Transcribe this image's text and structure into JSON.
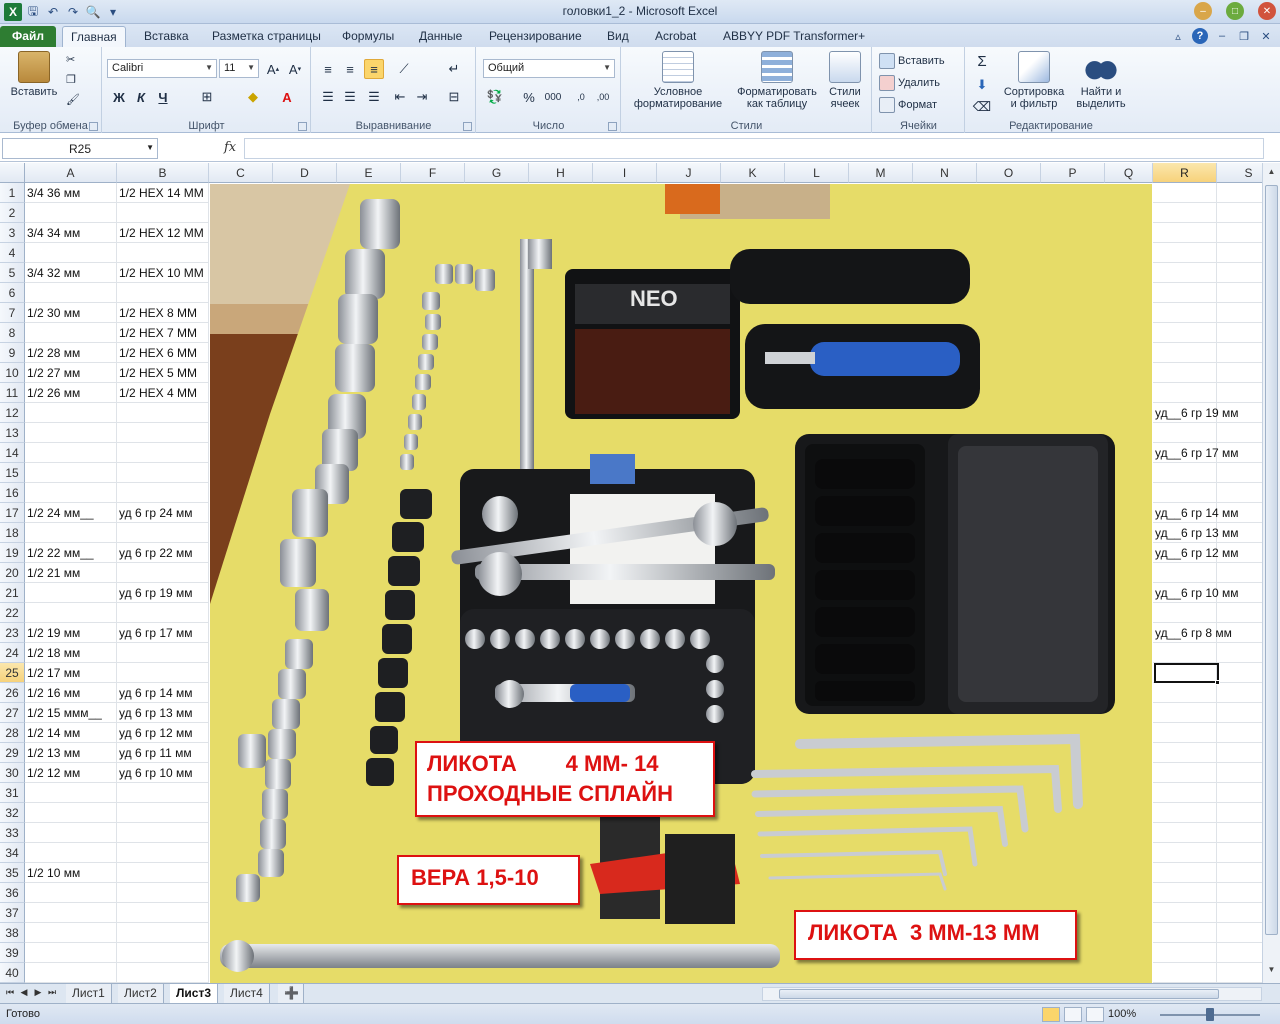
{
  "window": {
    "title": "головки1_2  -  Microsoft Excel",
    "app_icon": "X"
  },
  "ribbon_tabs": [
    "Файл",
    "Главная",
    "Вставка",
    "Разметка страницы",
    "Формулы",
    "Данные",
    "Рецензирование",
    "Вид",
    "Acrobat",
    "ABBYY PDF Transformer+"
  ],
  "ribbon": {
    "clipboard": {
      "group": "Буфер обмена",
      "paste": "Вставить"
    },
    "font": {
      "group": "Шрифт",
      "name": "Calibri",
      "size": "11",
      "bold": "Ж",
      "italic": "К",
      "underline": "Ч"
    },
    "alignment": {
      "group": "Выравнивание"
    },
    "number": {
      "group": "Число",
      "format": "Общий"
    },
    "styles": {
      "group": "Стили",
      "conditional": "Условное форматирование",
      "as_table": "Форматировать как таблицу",
      "cell_styles": "Стили ячеек"
    },
    "cells": {
      "group": "Ячейки",
      "insert": "Вставить",
      "delete": "Удалить",
      "format": "Формат"
    },
    "editing": {
      "group": "Редактирование",
      "sort": "Сортировка и фильтр",
      "find": "Найти и выделить"
    }
  },
  "formula_bar": {
    "name_box": "R25",
    "fx": "fx",
    "value": ""
  },
  "columns": [
    "A",
    "B",
    "C",
    "D",
    "E",
    "F",
    "G",
    "H",
    "I",
    "J",
    "K",
    "L",
    "M",
    "N",
    "O",
    "P",
    "Q",
    "R",
    "S"
  ],
  "selected_column": "R",
  "selected_row": 25,
  "rows": [
    1,
    2,
    3,
    4,
    5,
    6,
    7,
    8,
    9,
    10,
    11,
    12,
    13,
    14,
    15,
    16,
    17,
    18,
    19,
    20,
    21,
    22,
    23,
    24,
    25,
    26,
    27,
    28,
    29,
    30,
    31,
    32,
    33,
    34,
    35,
    36,
    37,
    38,
    39,
    40
  ],
  "cells": [
    {
      "row": 1,
      "a": "3/4 36 мм",
      "b": "1/2 HEX 14 MM",
      "r": ""
    },
    {
      "row": 3,
      "a": "3/4 34 мм",
      "b": "1/2 HEX 12 MM",
      "r": ""
    },
    {
      "row": 5,
      "a": "3/4 32 мм",
      "b": "1/2 HEX 10 MM",
      "r": ""
    },
    {
      "row": 7,
      "a": "1/2 30 мм",
      "b": "1/2 HEX 8 MM",
      "r": ""
    },
    {
      "row": 8,
      "a": "",
      "b": "1/2 HEX 7 MM",
      "r": ""
    },
    {
      "row": 9,
      "a": "1/2 28 мм",
      "b": "1/2 HEX 6 MM",
      "r": ""
    },
    {
      "row": 10,
      "a": "1/2 27 мм",
      "b": "1/2 HEX 5 MM",
      "r": ""
    },
    {
      "row": 11,
      "a": "1/2 26 мм",
      "b": "1/2 HEX 4 MM",
      "r": ""
    },
    {
      "row": 12,
      "a": "",
      "b": "",
      "r": "уд__6 гр 19 мм"
    },
    {
      "row": 14,
      "a": "",
      "b": "",
      "r": "уд__6 гр 17 мм"
    },
    {
      "row": 17,
      "a": "1/2 24 мм__",
      "b": "уд 6 гр 24 мм",
      "r": "уд__6 гр 14 мм"
    },
    {
      "row": 18,
      "a": "",
      "b": "",
      "r": "уд__6 гр 13 мм"
    },
    {
      "row": 19,
      "a": "1/2 22 мм__",
      "b": "уд 6 гр 22 мм",
      "r": "уд__6 гр 12 мм"
    },
    {
      "row": 20,
      "a": "1/2 21 мм",
      "b": "",
      "r": ""
    },
    {
      "row": 21,
      "a": "",
      "b": "уд 6 гр 19 мм",
      "r": "уд__6 гр 10 мм"
    },
    {
      "row": 23,
      "a": "1/2 19 мм",
      "b": "уд 6 гр 17 мм",
      "r": "уд__6 гр 8 мм"
    },
    {
      "row": 24,
      "a": "1/2 18 мм",
      "b": "",
      "r": ""
    },
    {
      "row": 25,
      "a": "1/2 17 мм",
      "b": "",
      "r": ""
    },
    {
      "row": 26,
      "a": "1/2 16 мм",
      "b": "уд 6 гр 14 мм",
      "r": ""
    },
    {
      "row": 27,
      "a": "1/2 15 ммм__",
      "b": "уд 6 гр 13 мм",
      "r": ""
    },
    {
      "row": 28,
      "a": "1/2 14 мм",
      "b": "уд 6 гр 12 мм",
      "r": ""
    },
    {
      "row": 29,
      "a": "1/2 13 мм",
      "b": "уд 6 гр 11 мм",
      "r": ""
    },
    {
      "row": 30,
      "a": "1/2 12 мм",
      "b": "уд 6 гр 10 мм",
      "r": ""
    },
    {
      "row": 35,
      "a": "1/2 10 мм",
      "b": "",
      "r": ""
    }
  ],
  "photo_labels": {
    "likota_1": "ЛИКОТА        4 ММ- 14",
    "likota_2": "ПРОХОДНЫЕ СПЛАЙН",
    "vera": "ВЕРА 1,5-10",
    "likota_3": "ЛИКОТА  3 ММ-13 ММ",
    "neo_brand": "NEO"
  },
  "sheets": [
    "Лист1",
    "Лист2",
    "Лист3",
    "Лист4"
  ],
  "active_sheet": "Лист3",
  "status": {
    "ready": "Готово",
    "zoom": "100%"
  },
  "colors": {
    "accent": "#2e7d32",
    "label_red": "#dd1111",
    "photo_bg": "#e7de6b",
    "selection": "#f7d27b"
  }
}
